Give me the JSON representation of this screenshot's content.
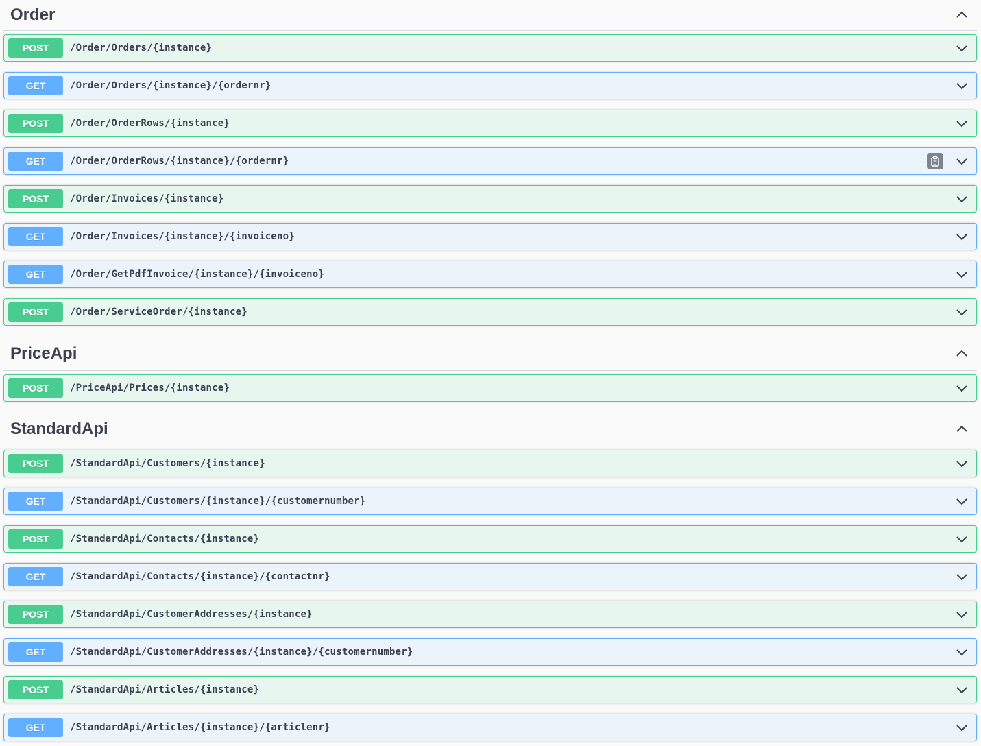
{
  "sections": [
    {
      "title": "Order",
      "operations": [
        {
          "method": "POST",
          "path": "/Order/Orders/{instance}"
        },
        {
          "method": "GET",
          "path": "/Order/Orders/{instance}/{ordernr}"
        },
        {
          "method": "POST",
          "path": "/Order/OrderRows/{instance}"
        },
        {
          "method": "GET",
          "path": "/Order/OrderRows/{instance}/{ordernr}"
        },
        {
          "method": "POST",
          "path": "/Order/Invoices/{instance}"
        },
        {
          "method": "GET",
          "path": "/Order/Invoices/{instance}/{invoiceno}"
        },
        {
          "method": "GET",
          "path": "/Order/GetPdfInvoice/{instance}/{invoiceno}"
        },
        {
          "method": "POST",
          "path": "/Order/ServiceOrder/{instance}"
        }
      ]
    },
    {
      "title": "PriceApi",
      "operations": [
        {
          "method": "POST",
          "path": "/PriceApi/Prices/{instance}"
        }
      ]
    },
    {
      "title": "StandardApi",
      "operations": [
        {
          "method": "POST",
          "path": "/StandardApi/Customers/{instance}"
        },
        {
          "method": "GET",
          "path": "/StandardApi/Customers/{instance}/{customernumber}"
        },
        {
          "method": "POST",
          "path": "/StandardApi/Contacts/{instance}"
        },
        {
          "method": "GET",
          "path": "/StandardApi/Contacts/{instance}/{contactnr}"
        },
        {
          "method": "POST",
          "path": "/StandardApi/CustomerAddresses/{instance}"
        },
        {
          "method": "GET",
          "path": "/StandardApi/CustomerAddresses/{instance}/{customernumber}"
        },
        {
          "method": "POST",
          "path": "/StandardApi/Articles/{instance}"
        },
        {
          "method": "GET",
          "path": "/StandardApi/Articles/{instance}/{articlenr}"
        }
      ]
    }
  ],
  "colors": {
    "post": "#49cc90",
    "get": "#61affe",
    "text": "#3b4151"
  },
  "icons": {
    "collapse": "chevron-up-icon",
    "expand": "chevron-down-icon",
    "copy": "copy-to-clipboard-icon"
  }
}
